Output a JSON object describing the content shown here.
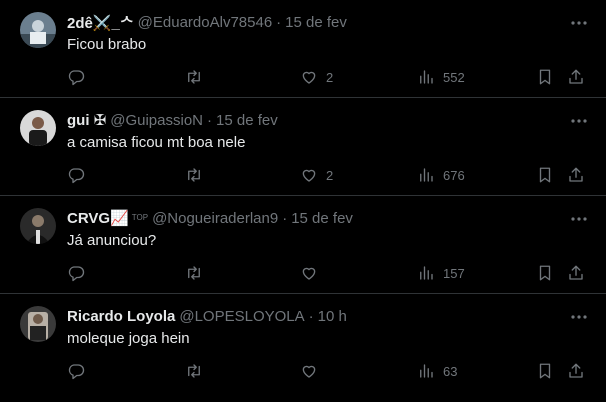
{
  "colors": {
    "background": "#000000",
    "text_primary": "#e7e9ea",
    "text_secondary": "#71767b",
    "divider": "#2f3336"
  },
  "tweets": [
    {
      "display_name": "2dê⚔️_ᄉ",
      "handle": "@EduardoAlv78546",
      "separator": "·",
      "time": "15 de fev",
      "text": "Ficou brabo",
      "likes": "2",
      "views": "552",
      "avatar_icon": "avatar-photo"
    },
    {
      "display_name": "gui ✠",
      "handle": "@GuipassioN",
      "separator": "·",
      "time": "15 de fev",
      "text": "a camisa ficou mt boa nele",
      "likes": "2",
      "views": "676",
      "avatar_icon": "avatar-photo"
    },
    {
      "display_name": "CRVG📈",
      "top_badge": "TOP",
      "handle": "@Nogueiraderlan9",
      "separator": "·",
      "time": "15 de fev",
      "text": "Já anunciou?",
      "likes": "",
      "views": "157",
      "avatar_icon": "avatar-photo"
    },
    {
      "display_name": "Ricardo Loyola",
      "handle": "@LOPESLOYOLA",
      "separator": "·",
      "time": "10 h",
      "text": "moleque joga hein",
      "likes": "",
      "views": "63",
      "avatar_icon": "avatar-photo"
    }
  ]
}
